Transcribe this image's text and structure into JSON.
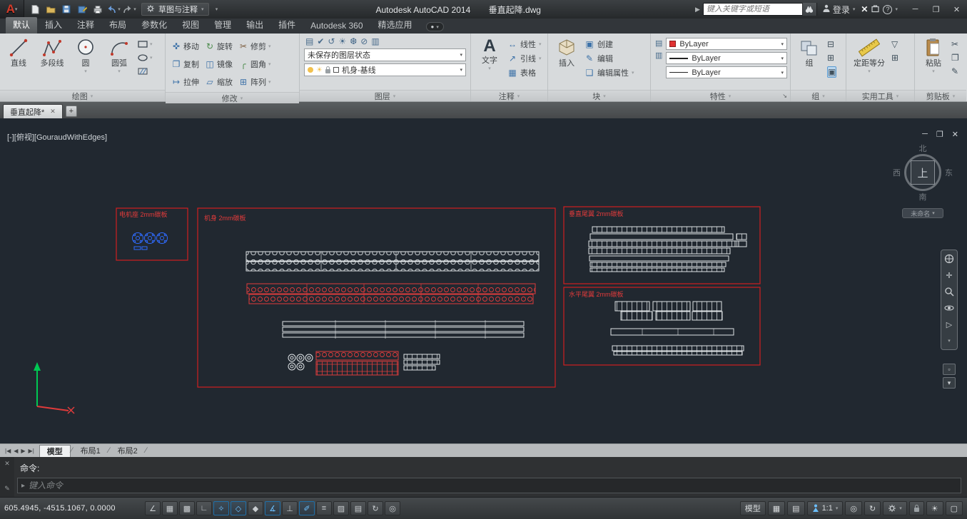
{
  "titlebar": {
    "workspace": "草图与注释",
    "app_title": "Autodesk AutoCAD 2014",
    "doc_title": "垂直起降.dwg",
    "search_placeholder": "键入关键字或短语",
    "signin": "登录"
  },
  "ribbon": {
    "tabs": [
      {
        "label": "默认"
      },
      {
        "label": "插入"
      },
      {
        "label": "注释"
      },
      {
        "label": "布局"
      },
      {
        "label": "参数化"
      },
      {
        "label": "视图"
      },
      {
        "label": "管理"
      },
      {
        "label": "输出"
      },
      {
        "label": "插件"
      },
      {
        "label": "Autodesk 360"
      },
      {
        "label": "精选应用"
      }
    ],
    "panels": {
      "draw": {
        "label": "绘图",
        "tools": [
          "直线",
          "多段线",
          "圆",
          "圆弧"
        ]
      },
      "modify": {
        "label": "修改",
        "tools": [
          "移动",
          "旋转",
          "修剪",
          "复制",
          "镜像",
          "圆角",
          "拉伸",
          "缩放",
          "阵列"
        ]
      },
      "layers": {
        "label": "图层",
        "state": "未保存的图层状态",
        "current": "机身-基线"
      },
      "annotate": {
        "label": "注释",
        "tools": [
          "文字",
          "线性",
          "引线",
          "表格"
        ]
      },
      "block": {
        "label": "块",
        "tools": [
          "插入",
          "创建",
          "编辑",
          "编辑属性"
        ]
      },
      "properties": {
        "label": "特性",
        "rows": [
          "ByLayer",
          "ByLayer",
          "ByLayer"
        ],
        "swatch_color": "#e03232"
      },
      "group": {
        "label": "组",
        "tools": [
          "组"
        ]
      },
      "utilities": {
        "label": "实用工具",
        "tools": [
          "定距等分"
        ]
      },
      "clipboard": {
        "label": "剪贴板",
        "tools": [
          "粘贴"
        ]
      }
    }
  },
  "file_tabs": {
    "active": "垂直起降*"
  },
  "viewport": {
    "corner": "[-][俯视][GouraudWithEdges]",
    "viewcube": {
      "n": "北",
      "s": "南",
      "w": "西",
      "e": "东",
      "top": "上",
      "menu": "未命名"
    },
    "regions": [
      {
        "label": "电机座 2mm碳板"
      },
      {
        "label": "机身 2mm碳板"
      },
      {
        "label": "垂直尾翼 2mm碳板"
      },
      {
        "label": "水平尾翼 2mm碳板"
      }
    ],
    "colors": {
      "background": "#212830",
      "region_outline": "#cf1f1f",
      "parts_white": "#dfe3e6",
      "parts_blue": "#2f6bff"
    }
  },
  "layout_tabs": {
    "items": [
      "模型",
      "布局1",
      "布局2"
    ]
  },
  "command": {
    "prompt": "命令:",
    "input_hint": "键入命令"
  },
  "statusbar": {
    "coordinates": "605.4945, -4515.1067, 0.0000",
    "toggles": [
      {
        "name": "infer-constraints",
        "glyph": "∠",
        "on": false
      },
      {
        "name": "snap-mode",
        "glyph": "▦",
        "on": false
      },
      {
        "name": "grid-display",
        "glyph": "▩",
        "on": false
      },
      {
        "name": "ortho-mode",
        "glyph": "∟",
        "on": false
      },
      {
        "name": "polar-tracking",
        "glyph": "✧",
        "on": true
      },
      {
        "name": "object-snap",
        "glyph": "◇",
        "on": true
      },
      {
        "name": "3d-object-snap",
        "glyph": "◆",
        "on": false
      },
      {
        "name": "object-snap-tracking",
        "glyph": "∡",
        "on": true
      },
      {
        "name": "dynamic-ucs",
        "glyph": "⊥",
        "on": false
      },
      {
        "name": "dynamic-input",
        "glyph": "✐",
        "on": true
      },
      {
        "name": "lineweight",
        "glyph": "≡",
        "on": false
      },
      {
        "name": "transparency",
        "glyph": "▨",
        "on": false
      },
      {
        "name": "quick-properties",
        "glyph": "▤",
        "on": false
      },
      {
        "name": "selection-cycling",
        "glyph": "↻",
        "on": false
      },
      {
        "name": "annotation-monitor",
        "glyph": "◎",
        "on": false
      }
    ],
    "model_button": "模型",
    "annotation_scale": "1:1"
  }
}
